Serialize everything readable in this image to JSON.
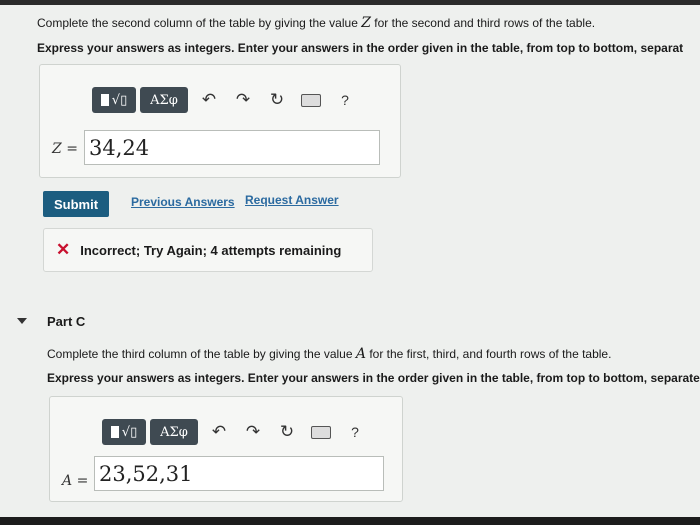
{
  "partB": {
    "instruction1_pre": "Complete the second column of the table by giving the value ",
    "instruction1_var": "Z",
    "instruction1_post": " for the second and third rows of the table.",
    "instruction2": "Express your answers as integers. Enter your answers in the order given in the table, from top to bottom, separat",
    "toolbar": {
      "template_label": "√▯",
      "greek_label": "ΑΣφ",
      "help_label": "?"
    },
    "var_name": "Z",
    "equals": "=",
    "answer_value": "34,24",
    "submit_label": "Submit",
    "previous_answers_label": "Previous Answers",
    "request_answer_label": "Request Answer",
    "feedback_text": "Incorrect; Try Again; 4 attempts remaining"
  },
  "partC": {
    "title": "Part C",
    "instruction1_pre": "Complete the third column of the table by giving the value ",
    "instruction1_var": "A",
    "instruction1_post": " for the first, third, and fourth rows of the table.",
    "instruction2": "Express your answers as integers. Enter your answers in the order given in the table, from top to bottom, separate",
    "toolbar": {
      "template_label": "√▯",
      "greek_label": "ΑΣφ",
      "help_label": "?"
    },
    "var_name": "A",
    "equals": "=",
    "answer_value": "23,52,31"
  },
  "colors": {
    "submit": "#1c5d80",
    "link": "#2b6aa0",
    "error": "#c8102e",
    "toolbar": "#3f4a52"
  }
}
